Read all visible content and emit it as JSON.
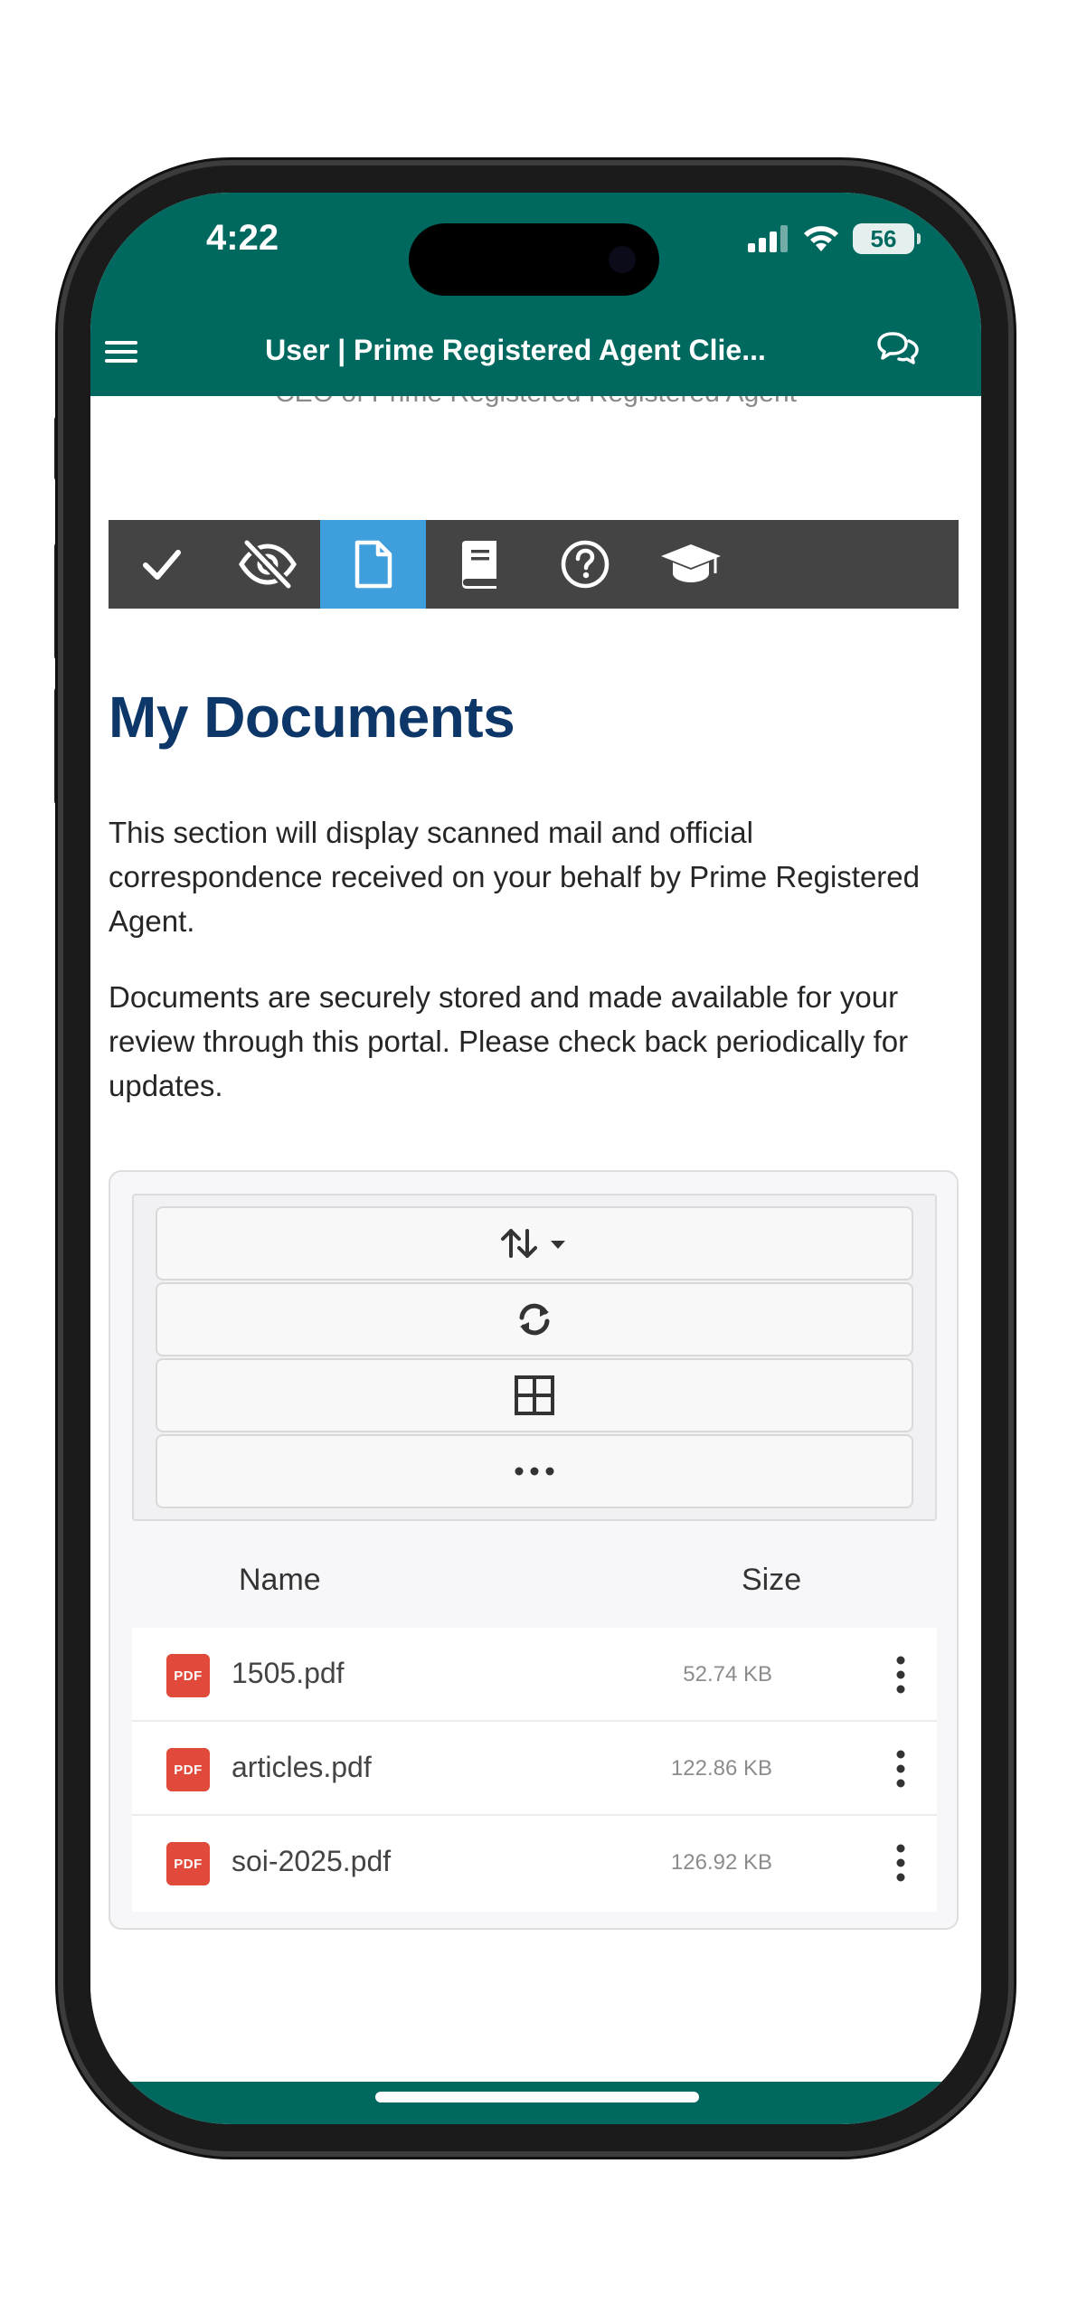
{
  "status_bar": {
    "time": "4:22",
    "battery": "56"
  },
  "app_bar": {
    "title": "User | Prime Registered Agent Clie..."
  },
  "profile": {
    "clipped_text": "CEO of Prime Registered Registered Agent"
  },
  "toolbar": {
    "tabs": [
      {
        "icon": "check-icon"
      },
      {
        "icon": "eye-slash-icon"
      },
      {
        "icon": "file-icon",
        "active": true
      },
      {
        "icon": "book-icon"
      },
      {
        "icon": "question-circle-icon"
      },
      {
        "icon": "graduation-cap-icon"
      }
    ]
  },
  "page": {
    "title": "My Documents",
    "paragraph1": "This section will display scanned mail and official correspondence received on your behalf by Prime Registered Agent.",
    "paragraph2": "Documents are securely stored and made available for your review through this portal. Please check back periodically for updates."
  },
  "file_manager": {
    "toolbar_buttons": [
      "sort-icon",
      "refresh-icon",
      "grid-view-icon",
      "more-icon"
    ],
    "columns": {
      "name": "Name",
      "size": "Size"
    },
    "files": [
      {
        "icon_text": "PDF",
        "name": "1505.pdf",
        "size": "52.74 KB"
      },
      {
        "icon_text": "PDF",
        "name": "articles.pdf",
        "size": "122.86 KB"
      },
      {
        "icon_text": "PDF",
        "name": "soi-2025.pdf",
        "size": "126.92 KB"
      }
    ]
  },
  "colors": {
    "brand_teal": "#00695f",
    "toolbar_dark": "#444444",
    "toolbar_active": "#3e9fdc",
    "heading_navy": "#0d3768",
    "pdf_red": "#e14a3b"
  }
}
